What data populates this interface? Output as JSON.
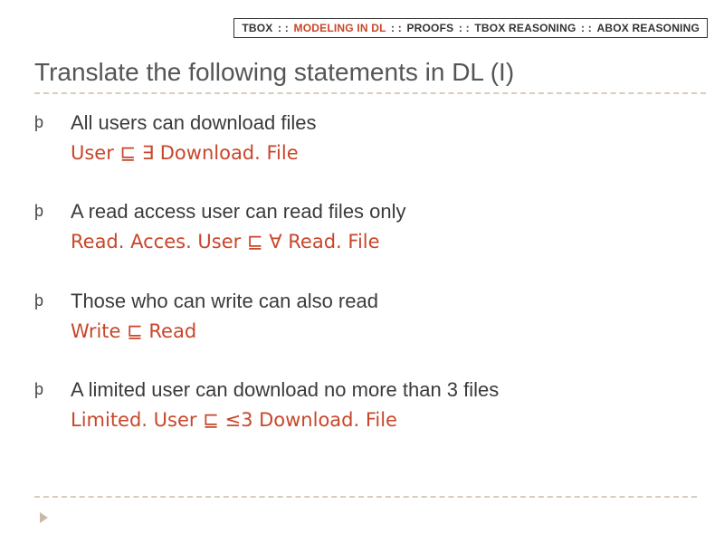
{
  "breadcrumb": {
    "items": [
      {
        "label": "TBOX",
        "active": false
      },
      {
        "label": "MODELING IN DL",
        "active": true
      },
      {
        "label": "PROOFS",
        "active": false
      },
      {
        "label": "TBOX REASONING",
        "active": false
      },
      {
        "label": "ABOX REASONING",
        "active": false
      }
    ],
    "sep": " : : "
  },
  "title": "Translate the following statements in DL (I)",
  "bullet_glyph": "þ",
  "items": [
    {
      "statement": "All users can download files",
      "formula": "User ⊑ ∃ Download. File"
    },
    {
      "statement": "A read access user can read files only",
      "formula": "Read. Acces. User ⊑ ∀ Read. File"
    },
    {
      "statement": "Those who can write can also read",
      "formula": "Write ⊑ Read"
    },
    {
      "statement": "A limited user can download no more than 3 files",
      "formula": "Limited. User ⊑ ≤3 Download. File"
    }
  ]
}
